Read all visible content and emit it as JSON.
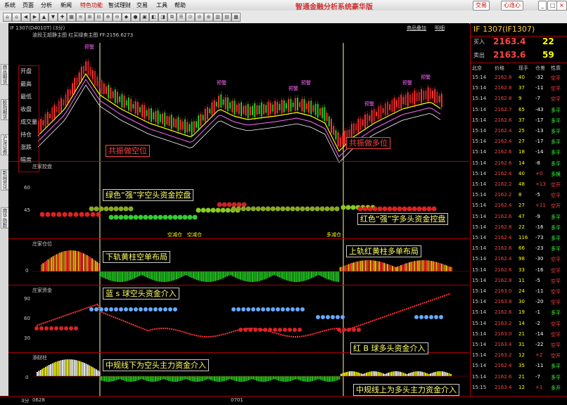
{
  "app": {
    "brand": "智通金融分析系统豪华版"
  },
  "menu": [
    {
      "label": "系统",
      "active": false
    },
    {
      "label": "页面",
      "active": false
    },
    {
      "label": "分析",
      "active": false
    },
    {
      "label": "新闻",
      "active": false
    },
    {
      "label": "特色功能",
      "active": true
    },
    {
      "label": "智试理财",
      "active": false
    },
    {
      "label": "交易",
      "active": false
    },
    {
      "label": "工具",
      "active": false
    },
    {
      "label": "帮助",
      "active": false
    }
  ],
  "top_buttons": {
    "trade": "交易",
    "heart": "心连心"
  },
  "left_tabs": [
    "商品期货",
    "股指期货",
    "沪深证券",
    "新闻资讯",
    "南华指数"
  ],
  "chart_header": {
    "symbol_line": "IF 1307(D4010T) (3分)",
    "main_title": "波段王超静主图 红买绿卖主图 FF:2156.6273",
    "link1": "商品叠加",
    "link2": "明细"
  },
  "stats": [
    "开盘",
    "最高",
    "最低",
    "收盘",
    "成交量",
    "持仓",
    "涨跌",
    "幅度"
  ],
  "panels": {
    "p2_title": "庄家控盘",
    "p3_title": "庄家仓位",
    "p4_title": "庄家资金",
    "p5_title": "添财柱",
    "p2_y": [
      "60",
      "45"
    ],
    "p3_y": [
      "0"
    ],
    "p4_y": [
      "90",
      "60",
      "30"
    ],
    "p5_y": [
      "0"
    ]
  },
  "markers": {
    "warn": "预警",
    "short_mark": "空减仓",
    "short_add": "空减仓",
    "multi": "多减仓"
  },
  "annotations": {
    "a1": "共振做空位",
    "a2": "共振做多位",
    "a3": "绿色“强”字空头资金控盘",
    "a4": "红色“强”字多头资金控盘",
    "a5": "下轨黄柱空单布局",
    "a6": "上轨红黄柱多单布局",
    "a7": "蓝 s 球空头资金介入",
    "a8": "红 B 球多头资金介入",
    "a9": "中规线下为空头主力资金介入",
    "a10": "中规线上为多头主力资金介入"
  },
  "right_panel": {
    "title": "IF  1307(IF1307)",
    "buy_label": "买入",
    "buy_price": "2163.4",
    "buy_vol": "22",
    "sell_label": "卖出",
    "sell_price": "2163.6",
    "sell_vol": "59",
    "headers": [
      "北京",
      "价格",
      "现手",
      "仓差",
      "性质"
    ],
    "rows": [
      [
        "15:14",
        "2162.8",
        "40",
        "-32",
        "空平"
      ],
      [
        "15:14",
        "2162.8",
        "37",
        "-11",
        "空平"
      ],
      [
        "15:14",
        "2162.8",
        "9",
        "-7",
        "空平"
      ],
      [
        "15:14",
        "2162.7",
        "65",
        "-43",
        "多平"
      ],
      [
        "15:14",
        "2162.6",
        "37",
        "-17",
        "多平"
      ],
      [
        "15:14",
        "2162.4",
        "25",
        "-13",
        "多平"
      ],
      [
        "15:14",
        "2162.4",
        "27",
        "-17",
        "多平"
      ],
      [
        "15:14",
        "2162.6",
        "18",
        "-14",
        "多平"
      ],
      [
        "15:14",
        "2162.6",
        "14",
        "-8",
        "多平"
      ],
      [
        "15:14",
        "2162.4",
        "40",
        "+0",
        "多换"
      ],
      [
        "15:14",
        "2162.2",
        "48",
        "+13",
        "空开"
      ],
      [
        "15:14",
        "2162.2",
        "8",
        "-5",
        "空平"
      ],
      [
        "15:14",
        "2162.4",
        "27",
        "+11",
        "空开"
      ],
      [
        "15:14",
        "2162.6",
        "47",
        "-9",
        "多平"
      ],
      [
        "15:14",
        "2162.8",
        "22",
        "-16",
        "多平"
      ],
      [
        "15:14",
        "2162.4",
        "116",
        "-73",
        "多平"
      ],
      [
        "15:14",
        "2162.6",
        "66",
        "-23",
        "多平"
      ],
      [
        "15:14",
        "2162.4",
        "98",
        "-30",
        "空平"
      ],
      [
        "15:14",
        "2162.6",
        "33",
        "-16",
        "空平"
      ],
      [
        "15:14",
        "2162.8",
        "11",
        "-5",
        "空平"
      ],
      [
        "15:14",
        "2163.0",
        "24",
        "-11",
        "空平"
      ],
      [
        "15:14",
        "2163.8",
        "30",
        "-20",
        "空平"
      ],
      [
        "15:14",
        "2162.6",
        "19",
        "-1",
        "多平"
      ],
      [
        "15:14",
        "2163.2",
        "14",
        "-2",
        "空平"
      ],
      [
        "15:14",
        "2163.0",
        "21",
        "-14",
        "空平"
      ],
      [
        "15:14",
        "2163.4",
        "31",
        "-22",
        "空平"
      ],
      [
        "15:14",
        "2163.2",
        "12",
        "+2",
        "空开"
      ],
      [
        "15:14",
        "2162.4",
        "35",
        "-11",
        "多平"
      ],
      [
        "15:14",
        "2162.6",
        "21",
        "-7",
        "多平"
      ],
      [
        "15:15",
        "2163.4",
        "12",
        "+1",
        "多开"
      ]
    ]
  },
  "bottom": {
    "left": "3分",
    "date1": "0628",
    "date2": "0701"
  }
}
